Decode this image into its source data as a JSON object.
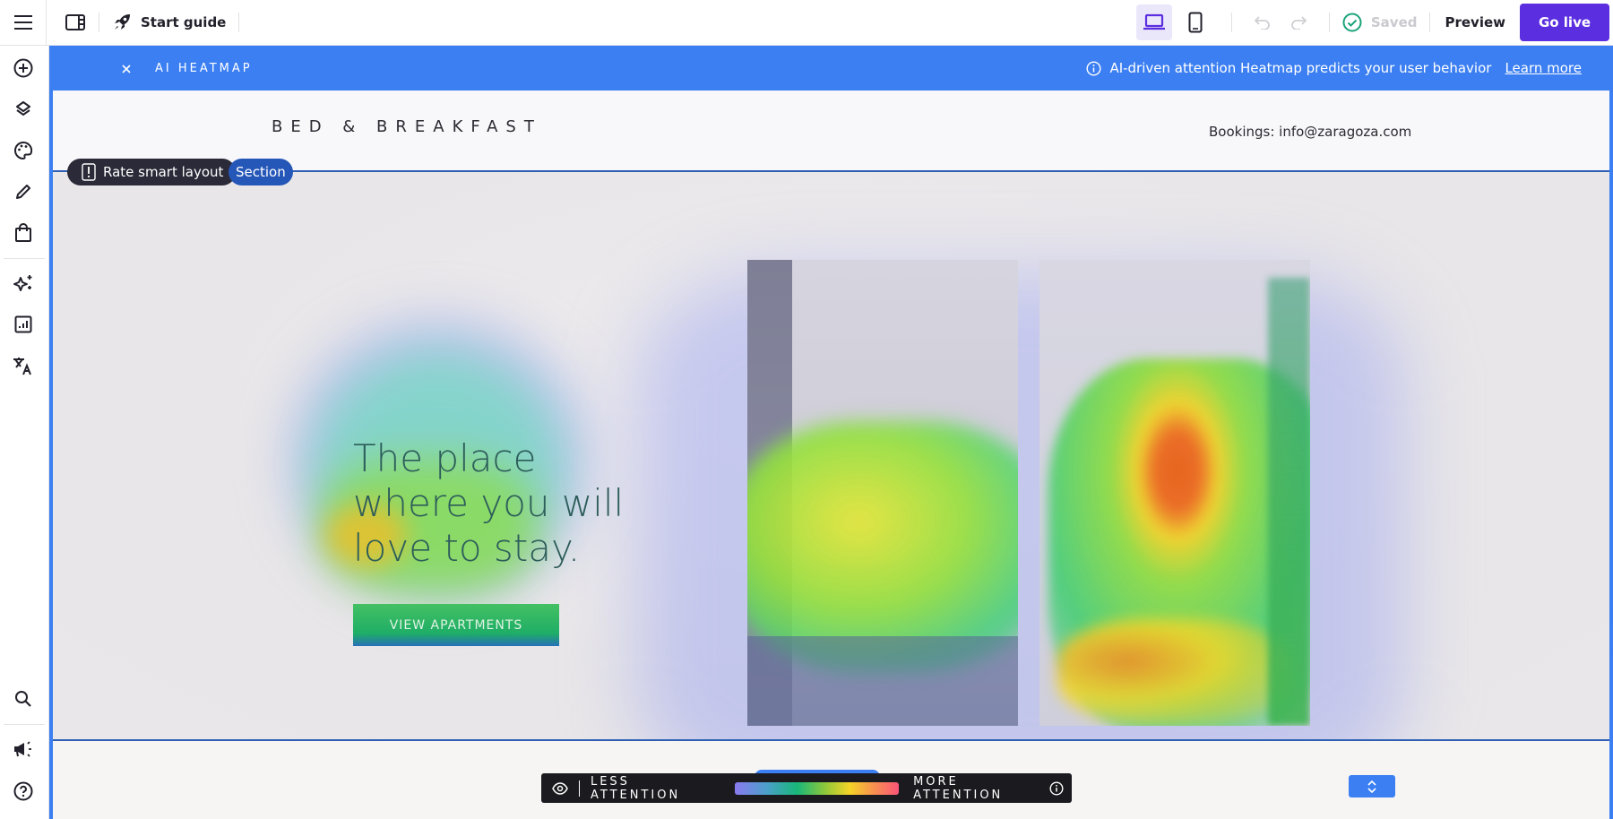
{
  "topbar": {
    "start_guide_label": "Start guide",
    "saved_label": "Saved",
    "preview_label": "Preview",
    "go_live_label": "Go live",
    "active_device": "desktop"
  },
  "sidebar": {
    "items": [
      {
        "name": "add",
        "icon": "plus-circle-icon"
      },
      {
        "name": "layers",
        "icon": "layers-icon"
      },
      {
        "name": "design",
        "icon": "palette-icon"
      },
      {
        "name": "edit",
        "icon": "pencil-icon"
      },
      {
        "name": "store",
        "icon": "shopping-bag-icon"
      },
      {
        "name": "ai",
        "icon": "sparkles-icon"
      },
      {
        "name": "analytics",
        "icon": "chart-icon"
      },
      {
        "name": "translate",
        "icon": "translate-icon"
      },
      {
        "name": "search",
        "icon": "search-icon"
      },
      {
        "name": "announcements",
        "icon": "megaphone-icon"
      },
      {
        "name": "help",
        "icon": "help-icon"
      }
    ]
  },
  "heatmap_bar": {
    "title": "AI HEATMAP",
    "info_text": "AI-driven attention Heatmap predicts your user behavior",
    "learn_more": "Learn more"
  },
  "site": {
    "brand": "BED & BREAKFAST",
    "bookings": "Bookings: info@zaragoza.com",
    "headline_lines": [
      "The place",
      "where you will",
      "love to stay."
    ],
    "cta_label": "VIEW APARTMENTS"
  },
  "editor": {
    "rate_label": "Rate smart layout",
    "section_label": "Section"
  },
  "legend": {
    "less_label": "LESS ATTENTION",
    "more_label": "MORE ATTENTION",
    "colors": [
      "#8a7af0",
      "#18b67a",
      "#f5d327",
      "#fb5478"
    ]
  },
  "colors": {
    "accent": "#3b7ff2",
    "go_live": "#5b2ee0",
    "saved_check": "#1aa37a"
  }
}
